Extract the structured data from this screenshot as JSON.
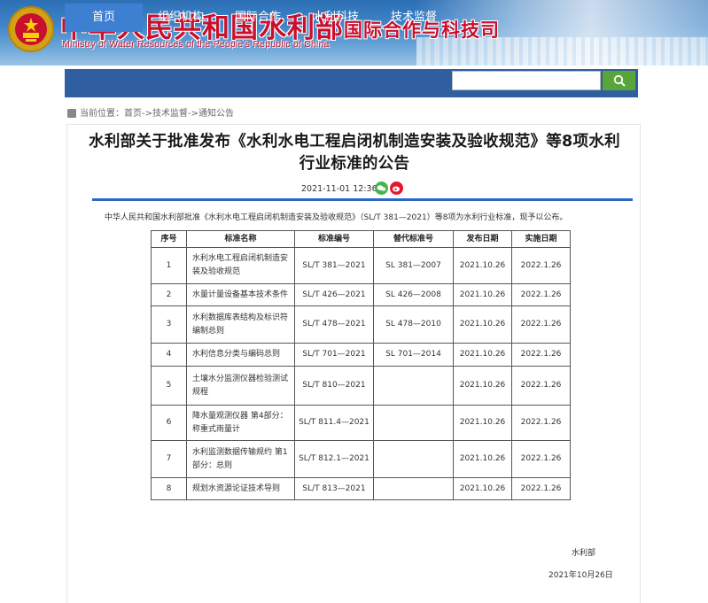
{
  "header": {
    "site_title": "中华人民共和国水利部",
    "site_subtitle": "Ministry of Water Resources of the People's Republic of China",
    "dept_title": "国际合作与科技司"
  },
  "nav": {
    "items": [
      {
        "label": "首页"
      },
      {
        "label": "组织机构"
      },
      {
        "label": "国际合作"
      },
      {
        "label": "水利科技"
      },
      {
        "label": "技术监督"
      }
    ],
    "active_index": 0
  },
  "breadcrumb": {
    "label": "当前位置：",
    "path": "首页->技术监督->通知公告"
  },
  "article": {
    "title": "水利部关于批准发布《水利水电工程启闭机制造安装及验收规范》等8项水利行业标准的公告",
    "datetime": "2021-11-01 12:36",
    "intro": "中华人民共和国水利部批准《水利水电工程启闭机制造安装及验收规范》（SL/T 381—2021）等8项为水利行业标准，现予以公布。",
    "signer": "水利部",
    "sign_date": "2021年10月26日"
  },
  "table": {
    "headers": [
      "序号",
      "标准名称",
      "标准编号",
      "替代标准号",
      "发布日期",
      "实施日期"
    ],
    "rows": [
      {
        "no": "1",
        "name": "水利水电工程启闭机制造安装及验收规范",
        "code": "SL/T 381—2021",
        "replace": "SL 381—2007",
        "pub": "2021.10.26",
        "impl": "2022.1.26"
      },
      {
        "no": "2",
        "name": "水量计量设备基本技术条件",
        "code": "SL/T 426—2021",
        "replace": "SL 426—2008",
        "pub": "2021.10.26",
        "impl": "2022.1.26"
      },
      {
        "no": "3",
        "name": "水利数据库表结构及标识符编制总则",
        "code": "SL/T 478—2021",
        "replace": "SL 478—2010",
        "pub": "2021.10.26",
        "impl": "2022.1.26"
      },
      {
        "no": "4",
        "name": "水利信息分类与编码总则",
        "code": "SL/T 701—2021",
        "replace": "SL 701—2014",
        "pub": "2021.10.26",
        "impl": "2022.1.26"
      },
      {
        "no": "5",
        "name": "土壤水分监测仪器检验测试规程",
        "code": "SL/T 810—2021",
        "replace": "",
        "pub": "2021.10.26",
        "impl": "2022.1.26"
      },
      {
        "no": "6",
        "name": "降水量观测仪器 第4部分：称重式雨量计",
        "code": "SL/T 811.4—2021",
        "replace": "",
        "pub": "2021.10.26",
        "impl": "2022.1.26"
      },
      {
        "no": "7",
        "name": "水利监测数据传输规约 第1部分：总则",
        "code": "SL/T 812.1—2021",
        "replace": "",
        "pub": "2021.10.26",
        "impl": "2022.1.26"
      },
      {
        "no": "8",
        "name": "规划水资源论证技术导则",
        "code": "SL/T 813—2021",
        "replace": "",
        "pub": "2021.10.26",
        "impl": "2022.1.26"
      }
    ]
  },
  "colors": {
    "nav_bg": "#2f5fa0",
    "nav_active": "#3d7fd0",
    "title_red": "#c8102e",
    "accent_blue": "#2a67c6",
    "search_green": "#5aa53a"
  },
  "icons": {
    "emblem": "national-emblem-icon",
    "search": "search-icon",
    "wechat": "wechat-icon",
    "weibo": "weibo-icon",
    "location": "location-icon"
  }
}
